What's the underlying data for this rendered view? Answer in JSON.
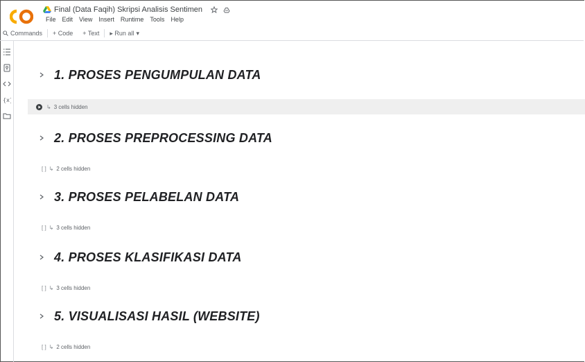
{
  "app": {
    "logo_text": "CO",
    "doc_title": "Final (Data Faqih) Skripsi Analisis Sentimen",
    "colors": {
      "logo_orange": "#f9ab00",
      "logo_dark": "#e8710a",
      "accent_blue": "#1a73e8"
    }
  },
  "menu": [
    "File",
    "Edit",
    "View",
    "Insert",
    "Runtime",
    "Tools",
    "Help"
  ],
  "toolbar": {
    "commands_label": "Commands",
    "code_label": "+ Code",
    "text_label": "+ Text",
    "runall_label": "▸ Run all",
    "runall_caret": "▾"
  },
  "sidebar": {
    "icons": [
      "table-of-contents-icon",
      "key-icon",
      "code-icon",
      "variables-icon",
      "folder-icon"
    ]
  },
  "sections": [
    {
      "heading": "1. PROSES PENGUMPULAN DATA",
      "hidden_text": "3 cells hidden",
      "active": true
    },
    {
      "heading": "2. PROSES PREPROCESSING DATA",
      "hidden_text": "2 cells hidden",
      "active": false
    },
    {
      "heading": "3. PROSES PELABELAN DATA",
      "hidden_text": "3 cells hidden",
      "active": false
    },
    {
      "heading": "4. PROSES KLASIFIKASI DATA",
      "hidden_text": "3 cells hidden",
      "active": false
    },
    {
      "heading": "5. VISUALISASI HASIL (WEBSITE)",
      "hidden_text": "2 cells hidden",
      "active": false
    }
  ]
}
